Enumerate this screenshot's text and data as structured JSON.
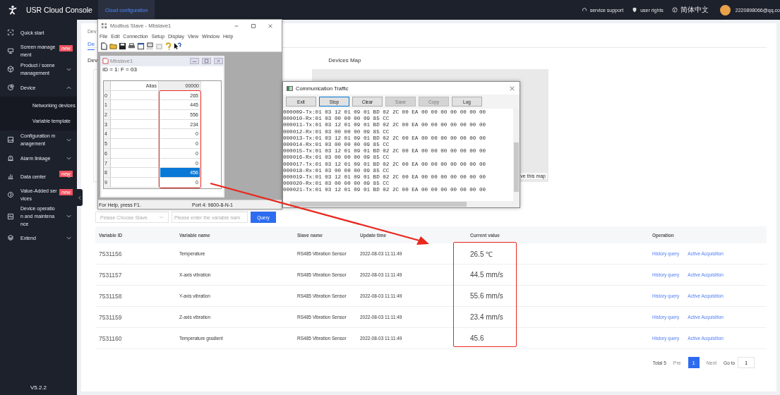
{
  "topbar": {
    "title": "USR Cloud Console",
    "tabs": [
      {
        "label": "Cloud configuration",
        "selected": true
      }
    ],
    "links": [
      {
        "label": "service support"
      },
      {
        "label": "user rights"
      },
      {
        "label": "简体中文"
      }
    ],
    "user": "2220898066@qq.co"
  },
  "sidebar": {
    "items": [
      {
        "label": "Quick start",
        "kind": "link"
      },
      {
        "label": "Screen management",
        "kind": "link",
        "badge": "new"
      },
      {
        "label": "Product / scene management",
        "kind": "group",
        "expanded": false
      },
      {
        "label": "Device",
        "kind": "group",
        "expanded": true,
        "children": [
          {
            "label": "Networking devices"
          },
          {
            "label": "Variable template"
          }
        ]
      },
      {
        "label": "Configuration management",
        "kind": "group",
        "expanded": false
      },
      {
        "label": "Alarm linkage",
        "kind": "group",
        "expanded": false
      },
      {
        "label": "Data center",
        "kind": "group",
        "expanded": false,
        "badge": "new"
      },
      {
        "label": "Value-Added services",
        "kind": "link",
        "badge": "new"
      },
      {
        "label": "Device operation and maintenance",
        "kind": "group",
        "expanded": false
      },
      {
        "label": "Extend",
        "kind": "group",
        "expanded": false
      }
    ],
    "version": "V5.2.2"
  },
  "page": {
    "breadcrumb": "Dev",
    "tab": "De",
    "section_label": "Dev",
    "map_title": "Devices Map",
    "map_link": "ve this map"
  },
  "filter": {
    "slave_select": {
      "placeholder": "Pelase Choose Slave"
    },
    "variable_input": {
      "placeholder": "Please enter the variable nam"
    },
    "query_button": "Query"
  },
  "table": {
    "columns": [
      "Variable ID",
      "Variable name",
      "Slave name",
      "Update time",
      "Current value",
      "Operation"
    ],
    "rows": [
      {
        "id": "7531156",
        "name": "Temperature",
        "slave": "RS485 Vibration Sensor",
        "time": "2022-08-03 11:11:49",
        "value": "26.5 ℃",
        "actions": [
          "History query",
          "Active Acquisition"
        ]
      },
      {
        "id": "7531157",
        "name": "X-axis vibration",
        "slave": "RS485 Vibration Sensor",
        "time": "2022-08-03 11:11:49",
        "value": "44.5 mm/s",
        "actions": [
          "History query",
          "Active Acquisition"
        ]
      },
      {
        "id": "7531158",
        "name": "Y-axis vibration",
        "slave": "RS485 Vibration Sensor",
        "time": "2022-08-03 11:11:49",
        "value": "55.6 mm/s",
        "actions": [
          "History query",
          "Active Acquisition"
        ]
      },
      {
        "id": "7531159",
        "name": "Z-axis vibration",
        "slave": "RS485 Vibration Sensor",
        "time": "2022-08-03 11:11:49",
        "value": "23.4 mm/s",
        "actions": [
          "History query",
          "Active Acquisition"
        ]
      },
      {
        "id": "7531160",
        "name": "Temperature gradient",
        "slave": "RS485 Vibration Sensor",
        "time": "2022-08-03 11:11:49",
        "value": "45.6",
        "actions": [
          "History query",
          "Active Acquisition"
        ]
      }
    ]
  },
  "pagination": {
    "total": "Total 5",
    "prev": "Pre",
    "pages": [
      {
        "label": "1",
        "selected": true
      }
    ],
    "next": "Next",
    "goto_label": "Go to",
    "goto_value": "1"
  },
  "modbus_window": {
    "title": "Modbus Slave - Mbslave1",
    "menu": [
      "File",
      "Edit",
      "Connection",
      "Setup",
      "Display",
      "View",
      "Window",
      "Help"
    ],
    "child": {
      "title": "Mbslave1",
      "header": "ID = 1: F = 03",
      "columns": [
        "Alias",
        "00000"
      ],
      "rows": [
        {
          "index": "0",
          "value": "265",
          "selected": false
        },
        {
          "index": "1",
          "value": "445",
          "selected": false
        },
        {
          "index": "2",
          "value": "556",
          "selected": false
        },
        {
          "index": "3",
          "value": "234",
          "selected": false
        },
        {
          "index": "4",
          "value": "0",
          "selected": false
        },
        {
          "index": "5",
          "value": "0",
          "selected": false
        },
        {
          "index": "6",
          "value": "0",
          "selected": false
        },
        {
          "index": "7",
          "value": "0",
          "selected": false
        },
        {
          "index": "8",
          "value": "456",
          "selected": true
        },
        {
          "index": "9",
          "value": "0",
          "selected": false
        }
      ]
    },
    "status": [
      "For Help, press F1.",
      "Port 4: 9600-8-N-1"
    ]
  },
  "traffic_window": {
    "title": "Communication Traffic",
    "buttons": [
      {
        "label": "Exit",
        "disabled": false,
        "focused": false
      },
      {
        "label": "Stop",
        "disabled": false,
        "focused": true
      },
      {
        "label": "Clear",
        "disabled": false,
        "focused": false
      },
      {
        "label": "Save",
        "disabled": true,
        "focused": false
      },
      {
        "label": "Copy",
        "disabled": true,
        "focused": false
      },
      {
        "label": "Log",
        "disabled": false,
        "focused": false
      }
    ],
    "lines": [
      "000009-Tx:01 03 12 01 09 01 BD 02 2C 00 EA 00 00 00 00 00 00 00",
      "000010-Rx:01 03 00 00 00 09 85 CC",
      "000011-Tx:01 03 12 01 09 01 BD 02 2C 00 EA 00 00 00 00 00 00 00",
      "000012-Rx:01 03 00 00 00 09 85 CC",
      "000013-Tx:01 03 12 01 09 01 BD 02 2C 00 EA 00 00 00 00 00 00 00",
      "000014-Rx:01 03 00 00 00 09 85 CC",
      "000015-Tx:01 03 12 01 09 01 BD 02 2C 00 EA 00 00 00 00 00 00 00",
      "000016-Rx:01 03 00 00 00 09 85 CC",
      "000017-Tx:01 03 12 01 09 01 BD 02 2C 00 EA 00 00 00 00 00 00 00",
      "000018-Rx:01 03 00 00 00 09 85 CC",
      "000019-Tx:01 03 12 01 09 01 BD 02 2C 00 EA 00 00 00 00 00 00 00",
      "000020-Rx:01 03 00 00 00 09 85 CC",
      "000021-Tx:01 03 12 01 09 01 BD 02 2C 00 EA 00 00 00 00 00 00 00"
    ]
  }
}
